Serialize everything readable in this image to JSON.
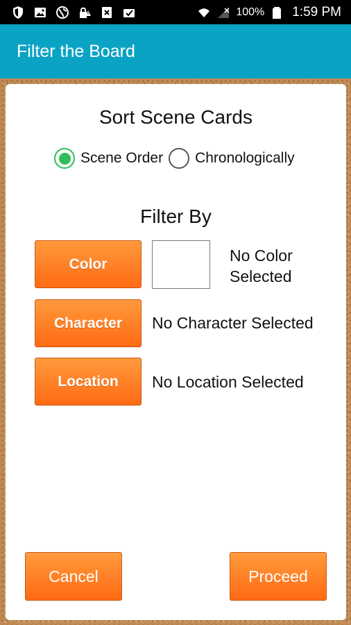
{
  "status_bar": {
    "icons_left": [
      "shield-icon",
      "image-icon",
      "globe-icon",
      "lock-warning-icon",
      "close-box-icon",
      "clipboard-check-icon"
    ],
    "battery": "100%",
    "time": "1:59 PM"
  },
  "app_bar": {
    "title": "Filter the Board",
    "color": "#0ba3c4"
  },
  "sort": {
    "title": "Sort Scene Cards",
    "options": [
      {
        "label": "Scene Order",
        "selected": true
      },
      {
        "label": "Chronologically",
        "selected": false
      }
    ],
    "accent": "#2ebd57"
  },
  "filter": {
    "title": "Filter By",
    "color_button": "Color",
    "color_status": "No Color Selected",
    "character_button": "Character",
    "character_status": "No Character Selected",
    "location_button": "Location",
    "location_status": "No Location Selected"
  },
  "footer": {
    "cancel": "Cancel",
    "proceed": "Proceed"
  },
  "colors": {
    "button": "#ff7a1f"
  }
}
